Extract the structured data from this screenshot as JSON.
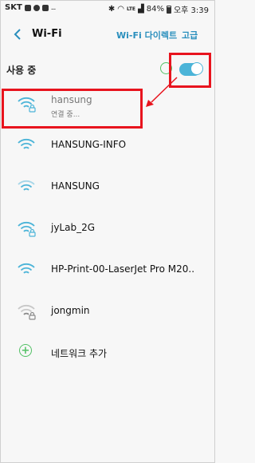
{
  "status_bar": {
    "carrier": "SKT",
    "indicators_left": "...",
    "battery": "84%",
    "time": "오후 3:39",
    "network_label": "LTE"
  },
  "header": {
    "title": "Wi-Fi",
    "direct_label": "Wi-Fi 다이렉트",
    "advanced_label": "고급"
  },
  "wifi_toggle": {
    "label": "사용 중",
    "state": "on",
    "accent_color": "#4bb4d8"
  },
  "networks": [
    {
      "name": "hansung",
      "status": "연결 중...",
      "secured": true,
      "signal": "strong",
      "connecting": true
    },
    {
      "name": "HANSUNG-INFO",
      "status": "",
      "secured": false,
      "signal": "strong"
    },
    {
      "name": "HANSUNG",
      "status": "",
      "secured": false,
      "signal": "medium"
    },
    {
      "name": "jyLab_2G",
      "status": "",
      "secured": true,
      "signal": "strong"
    },
    {
      "name": "HP-Print-00-LaserJet Pro M20..",
      "status": "",
      "secured": false,
      "signal": "strong"
    },
    {
      "name": "jongmin",
      "status": "",
      "secured": true,
      "signal": "weak"
    }
  ],
  "add_network": {
    "label": "네트워크 추가"
  },
  "colors": {
    "highlight": "#e8141e",
    "link": "#2a8fbd",
    "wifi": "#4bb4d8",
    "add": "#53c166"
  }
}
